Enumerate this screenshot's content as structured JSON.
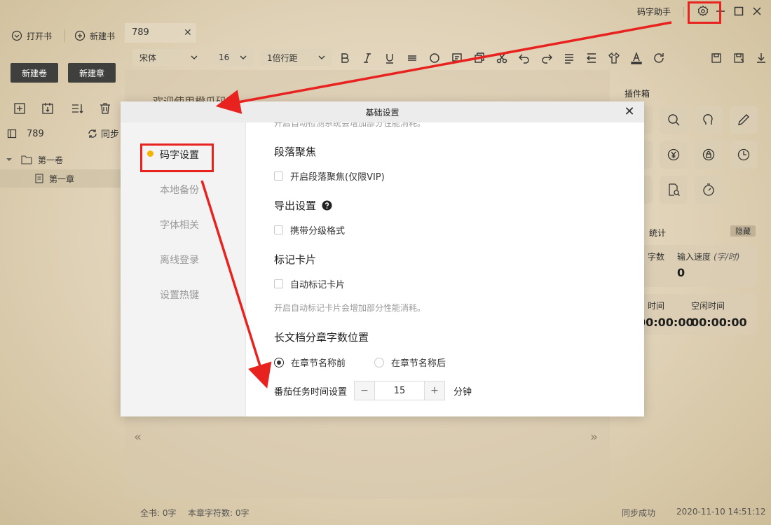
{
  "titlebar": {
    "app_name": "码字助手"
  },
  "sidebar": {
    "open_book": "打开书",
    "new_book": "新建书",
    "new_volume": "新建卷",
    "new_chapter": "新建章",
    "book_name": "789",
    "sync": "同步",
    "tree": [
      {
        "label": "第一卷"
      },
      {
        "label": "第一章"
      }
    ]
  },
  "editor": {
    "tab_title": "789",
    "font_family": "宋体",
    "font_size": "16",
    "line_spacing": "1倍行距",
    "paper_text": "欢迎使用橙瓜码字"
  },
  "right_panel": {
    "plugins_title": "插件箱",
    "stats_title": "统计",
    "hide": "隐藏",
    "word_count_label": "字数",
    "input_speed_label": "输入速度",
    "input_speed_unit": "(字/时)",
    "input_speed_value": "0",
    "code_time_label": "时间",
    "code_time_value": "00:00:00",
    "idle_time_label": "空闲时间",
    "idle_time_value": "00:00:00"
  },
  "statusbar": {
    "total": "全书: 0字",
    "chapter": "本章字符数: 0字",
    "sync_status": "同步成功",
    "datetime": "2020-11-10 14:51:12"
  },
  "modal": {
    "title": "基础设置",
    "nav": [
      {
        "label": "码字设置"
      },
      {
        "label": "本地备份"
      },
      {
        "label": "字体相关"
      },
      {
        "label": "离线登录"
      },
      {
        "label": "设置热键"
      }
    ],
    "top_cut_hint": "开启自动检测系统会增加部分性能消耗。",
    "para_focus_title": "段落聚焦",
    "para_focus_option": "开启段落聚焦(仅限VIP)",
    "export_title": "导出设置",
    "export_option": "携带分级格式",
    "mark_card_title": "标记卡片",
    "mark_card_option": "自动标记卡片",
    "mark_card_hint": "开启自动标记卡片会增加部分性能消耗。",
    "long_doc_title": "长文档分章字数位置",
    "position_before": "在章节名称前",
    "position_after": "在章节名称后",
    "pomodoro_label": "番茄任务时间设置",
    "pomodoro_value": "15",
    "pomodoro_unit": "分钟",
    "minus": "−",
    "plus": "+"
  },
  "colors": {
    "accent_dot": "#f4b400",
    "annotation_red": "#e8231f",
    "dark_button": "#404040"
  }
}
